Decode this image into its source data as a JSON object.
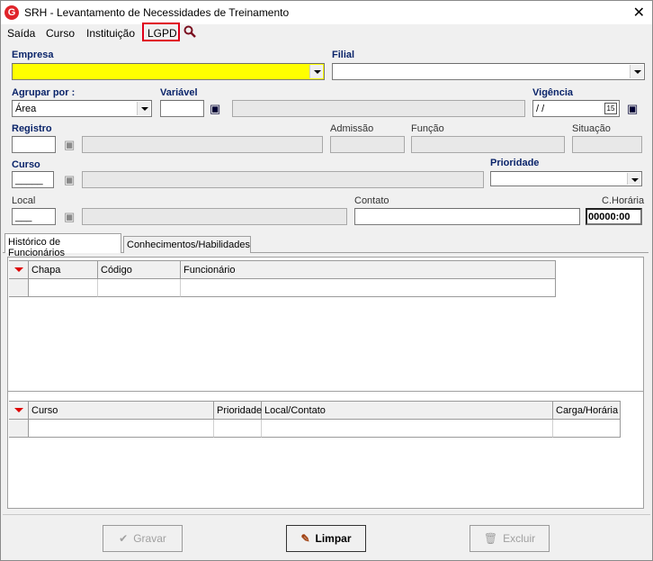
{
  "window": {
    "title": "SRH - Levantamento de Necessidades de Treinamento",
    "app_icon": "G",
    "close": "✕"
  },
  "menu": {
    "saida": "Saída",
    "curso": "Curso",
    "instituicao": "Instituição",
    "lgpd": "LGPD"
  },
  "form": {
    "empresa_label": "Empresa",
    "empresa_value": "",
    "filial_label": "Filial",
    "filial_value": "",
    "agrupar_label": "Agrupar por :",
    "agrupar_value": "Área",
    "variavel_label": "Variável",
    "vigencia_label": "Vigência",
    "vigencia_value": " / /",
    "calendar_day": "15",
    "registro_label": "Registro",
    "admissao_label": "Admissão",
    "funcao_label": "Função",
    "situacao_label": "Situação",
    "curso_label": "Curso",
    "curso_value": "_____",
    "prioridade_label": "Prioridade",
    "local_label": "Local",
    "local_value": "___",
    "contato_label": "Contato",
    "choraria_label": "C.Horária",
    "choraria_value": "00000:00"
  },
  "tabs": [
    {
      "label": "Histórico de Funcionários",
      "active": true
    },
    {
      "label": "Conhecimentos/Habilidades",
      "active": false
    }
  ],
  "grid1": {
    "columns": [
      "Chapa",
      "Código",
      "Funcionário"
    ]
  },
  "grid2": {
    "columns": [
      "Curso",
      "Prioridade",
      "Local/Contato",
      "Carga/Horária"
    ]
  },
  "buttons": {
    "gravar": "Gravar",
    "limpar": "Limpar",
    "excluir": "Excluir"
  },
  "colors": {
    "required_label": "#0a246a",
    "highlight_field": "#ffff00",
    "lgpd_box": "#e0001a"
  }
}
